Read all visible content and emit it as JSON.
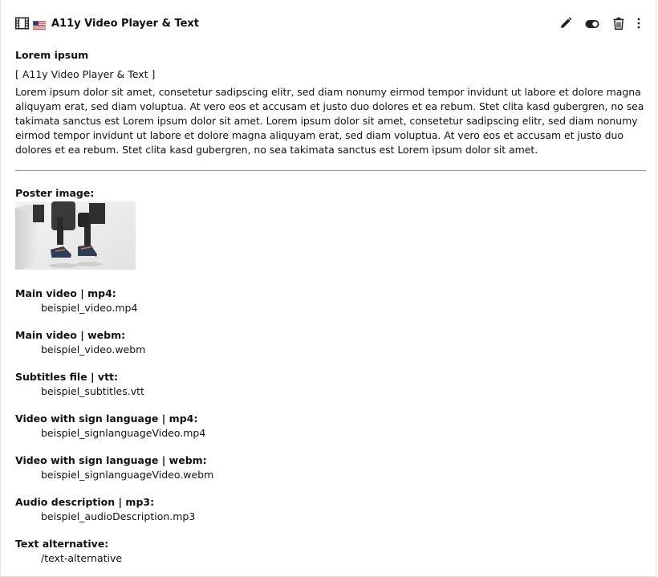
{
  "header": {
    "title": "A11y Video Player & Text",
    "icons": {
      "type": "film-icon",
      "language": "us-flag-icon",
      "edit": "pencil-icon",
      "toggle": "toggle-icon",
      "delete": "trash-icon",
      "more": "more-vertical-icon"
    }
  },
  "content": {
    "headline": "Lorem ipsum",
    "content_type": "[ A11y Video Player & Text ]",
    "bodytext": "Lorem ipsum dolor sit amet, consetetur sadipscing elitr, sed diam nonumy eirmod tempor invidunt ut labore et dolore magna aliquyam erat, sed diam voluptua. At vero eos et accusam et justo duo dolores et ea rebum. Stet clita kasd gubergren, no sea takimata sanctus est Lorem ipsum dolor sit amet. Lorem ipsum dolor sit amet, consetetur sadipscing elitr, sed diam nonumy eirmod tempor invidunt ut labore et dolore magna aliquyam erat, sed diam voluptua. At vero eos et accusam et justo duo dolores et ea rebum. Stet clita kasd gubergren, no sea takimata sanctus est Lorem ipsum dolor sit amet."
  },
  "poster": {
    "label": "Poster image:"
  },
  "fields": [
    {
      "label": "Main video | mp4:",
      "value": "beispiel_video.mp4"
    },
    {
      "label": "Main video | webm:",
      "value": "beispiel_video.webm"
    },
    {
      "label": "Subtitles file | vtt:",
      "value": "beispiel_subtitles.vtt"
    },
    {
      "label": "Video with sign language | mp4:",
      "value": "beispiel_signlanguageVideo.mp4"
    },
    {
      "label": "Video with sign language | webm:",
      "value": "beispiel_signlanguageVideo.webm"
    },
    {
      "label": "Audio description | mp3:",
      "value": "beispiel_audioDescription.mp3"
    },
    {
      "label": "Text alternative:",
      "value": "/text-alternative"
    }
  ]
}
